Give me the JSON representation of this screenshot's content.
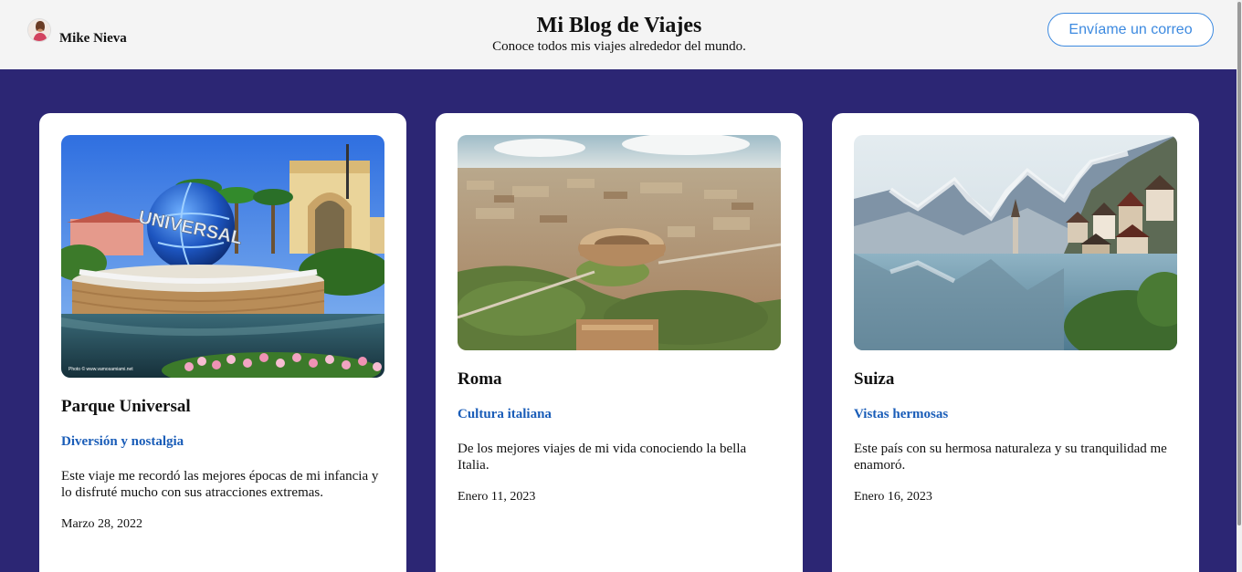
{
  "header": {
    "user_name": "Mike Nieva",
    "title": "Mi Blog de Viajes",
    "subtitle": "Conoce todos mis viajes alrededor del mundo.",
    "email_button": "Envíame un correo"
  },
  "cards": [
    {
      "title": "Parque Universal",
      "tag": "Diversión y nostalgia",
      "text": "Este viaje me recordó las mejores épocas de mi infancia y lo disfruté mucho con sus atracciones extremas.",
      "date": "Marzo 28, 2022",
      "image_globe_text": "UNIVERSAL",
      "image_credit": "Photo © www.vamosamiami.net"
    },
    {
      "title": "Roma",
      "tag": "Cultura italiana",
      "text": "De los mejores viajes de mi vida conociendo la bella Italia.",
      "date": "Enero 11, 2023"
    },
    {
      "title": "Suiza",
      "tag": "Vistas hermosas",
      "text": "Este país con su hermosa naturaleza y su tranquilidad me enamoró.",
      "date": "Enero 16, 2023"
    }
  ],
  "colors": {
    "page_background": "#2c2674",
    "header_background": "#f4f4f4",
    "accent": "#3d8ae0",
    "tag": "#1a5db8"
  }
}
